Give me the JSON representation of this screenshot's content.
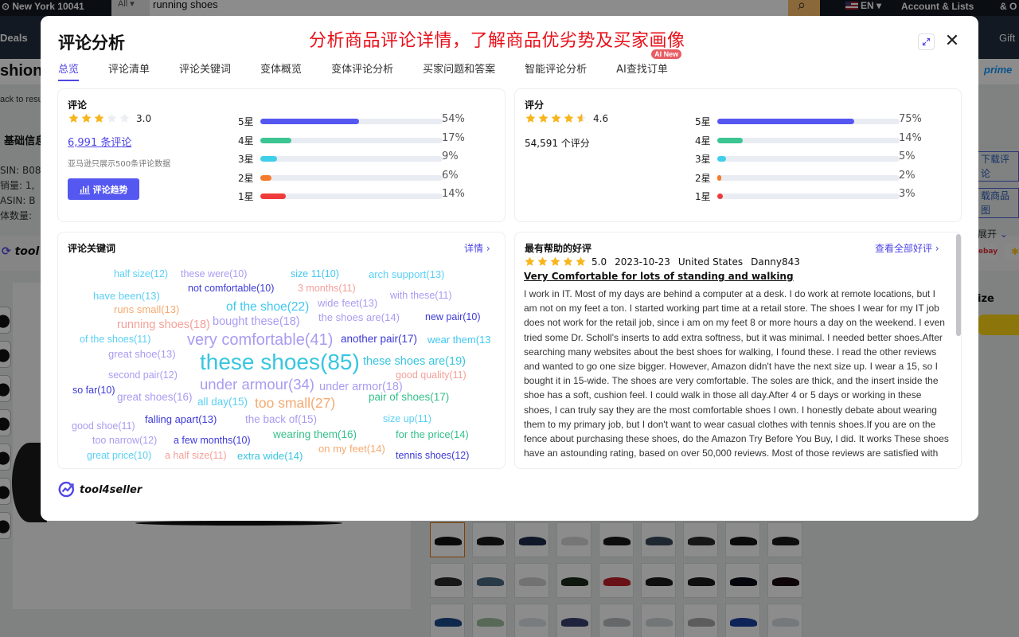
{
  "background": {
    "location": "New York 10041",
    "search_category": "All",
    "search_query": "running shoes",
    "language": "EN",
    "account": "Account & Lists",
    "orders": "& O",
    "nav_deals": "Deals",
    "nav_gift": "Gift",
    "page_heading": "shion",
    "prime": "prime",
    "back_link": "ack to resu",
    "basic_info": "基础信息",
    "info_rows": [
      "SIN:  B08",
      "销量:  1,",
      "ASIN:  B",
      "体数量:"
    ],
    "toolbar_brand": "tool",
    "right_links": [
      "下载评论",
      "载商品图"
    ],
    "expand_label": "展开",
    "size_label": "ize",
    "ebay": "ebay",
    "swatch_colors": [
      "#111",
      "#1a1a1a",
      "#1e2a4a",
      "#d8d8d8",
      "#181818",
      "#3a4a5a",
      "#2a2a2a",
      "#141414",
      "#1b1b1b",
      "#2b2b2b",
      "#4a6a80",
      "#d0d0d0",
      "#1b2b1b",
      "#c0202a",
      "#1a1a1a",
      "#1a1a1a",
      "#0a0a1a",
      "#1a0a10",
      "#1d4b8a",
      "#a0c0a0",
      "#dde2e8",
      "#3a4070",
      "#b8bcc0",
      "#cfd8d8",
      "#a8a8a8",
      "#1a40a0",
      "#d8dde2"
    ]
  },
  "modal": {
    "title": "评论分析",
    "banner": "分析商品评论详情，了解商品优劣势及买家画像",
    "tabs": [
      {
        "label": "总览",
        "active": true
      },
      {
        "label": "评论清单"
      },
      {
        "label": "评论关键词"
      },
      {
        "label": "变体概览"
      },
      {
        "label": "变体评论分析"
      },
      {
        "label": "买家问题和答案"
      },
      {
        "label": "智能评论分析"
      },
      {
        "label": "AI查找订单",
        "badge": "AI New"
      }
    ],
    "reviews": {
      "heading": "评论",
      "rating": 3.0,
      "rating_text": "3.0",
      "count_link": "6,991 条评论",
      "note": "亚马逊只展示500条评论数据",
      "trend_button": "评论趋势",
      "distribution": [
        {
          "label": "5星",
          "pct": 54,
          "pct_text": "54%",
          "color": "#5457f0"
        },
        {
          "label": "4星",
          "pct": 17,
          "pct_text": "17%",
          "color": "#3cc492"
        },
        {
          "label": "3星",
          "pct": 9,
          "pct_text": "9%",
          "color": "#40cfe8"
        },
        {
          "label": "2星",
          "pct": 6,
          "pct_text": "6%",
          "color": "#f57c2b"
        },
        {
          "label": "1星",
          "pct": 14,
          "pct_text": "14%",
          "color": "#ef3b3b"
        }
      ]
    },
    "ratings": {
      "heading": "评分",
      "rating": 4.6,
      "rating_text": "4.6",
      "count_text": "54,591 个评分",
      "distribution": [
        {
          "label": "5星",
          "pct": 75,
          "pct_text": "75%",
          "color": "#5457f0"
        },
        {
          "label": "4星",
          "pct": 14,
          "pct_text": "14%",
          "color": "#3cc492"
        },
        {
          "label": "3星",
          "pct": 5,
          "pct_text": "5%",
          "color": "#40cfe8"
        },
        {
          "label": "2星",
          "pct": 2,
          "pct_text": "2%",
          "color": "#f57c2b"
        },
        {
          "label": "1星",
          "pct": 3,
          "pct_text": "3%",
          "color": "#ef3b3b"
        }
      ]
    },
    "keywords": {
      "heading": "评论关键词",
      "detail_link": "详情 ›",
      "items": [
        {
          "text": "half size(12)",
          "count": 12,
          "color": "#5ad0f5"
        },
        {
          "text": "these were(10)",
          "count": 10,
          "color": "#a99cf2"
        },
        {
          "text": "size 11(10)",
          "count": 10,
          "color": "#40c8f0"
        },
        {
          "text": "arch support(13)",
          "count": 13,
          "color": "#5ad0f5"
        },
        {
          "text": "not comfortable(10)",
          "count": 10,
          "color": "#3d3ad6"
        },
        {
          "text": "3 months(11)",
          "count": 11,
          "color": "#f5a09a"
        },
        {
          "text": "have been(13)",
          "count": 13,
          "color": "#5ad0f5"
        },
        {
          "text": "with these(11)",
          "count": 11,
          "color": "#a99cf2"
        },
        {
          "text": "runs small(13)",
          "count": 13,
          "color": "#f5aa70"
        },
        {
          "text": "of the shoe(22)",
          "count": 22,
          "color": "#40c8f0"
        },
        {
          "text": "wide feet(13)",
          "count": 13,
          "color": "#a99cf2"
        },
        {
          "text": "running shoes(18)",
          "count": 18,
          "color": "#f5a09a"
        },
        {
          "text": "bought these(18)",
          "count": 18,
          "color": "#a99cf2"
        },
        {
          "text": "the shoes are(14)",
          "count": 14,
          "color": "#a99cf2"
        },
        {
          "text": "new pair(10)",
          "count": 10,
          "color": "#3d3ad6"
        },
        {
          "text": "of the shoes(11)",
          "count": 11,
          "color": "#5ad0f5"
        },
        {
          "text": "very comfortable(41)",
          "count": 41,
          "color": "#a99cf2"
        },
        {
          "text": "another pair(17)",
          "count": 17,
          "color": "#3d3ad6"
        },
        {
          "text": "wear them(13",
          "count": 13,
          "color": "#40c8f0"
        },
        {
          "text": "great shoe(13)",
          "count": 13,
          "color": "#a99cf2"
        },
        {
          "text": "these shoes(85)",
          "count": 85,
          "color": "#38c6e0"
        },
        {
          "text": "these shoes are(19)",
          "count": 19,
          "color": "#38c6e0"
        },
        {
          "text": "second pair(12)",
          "count": 12,
          "color": "#a99cf2"
        },
        {
          "text": "good quality(11)",
          "count": 11,
          "color": "#f5a09a"
        },
        {
          "text": "under armour(34)",
          "count": 34,
          "color": "#a99cf2"
        },
        {
          "text": "under armor(18)",
          "count": 18,
          "color": "#a99cf2"
        },
        {
          "text": "so far(10)",
          "count": 10,
          "color": "#3d3ad6"
        },
        {
          "text": "great shoes(16)",
          "count": 16,
          "color": "#a99cf2"
        },
        {
          "text": "all day(15)",
          "count": 15,
          "color": "#5ad0f5"
        },
        {
          "text": "too small(27)",
          "count": 27,
          "color": "#f5aa70"
        },
        {
          "text": "pair of shoes(17)",
          "count": 17,
          "color": "#36c08a"
        },
        {
          "text": "falling apart(13)",
          "count": 13,
          "color": "#3d3ad6"
        },
        {
          "text": "the back of(15)",
          "count": 15,
          "color": "#a99cf2"
        },
        {
          "text": "size up(11)",
          "count": 11,
          "color": "#5ad0f5"
        },
        {
          "text": "good shoe(11)",
          "count": 11,
          "color": "#a99cf2"
        },
        {
          "text": "wearing them(16)",
          "count": 16,
          "color": "#36c08a"
        },
        {
          "text": "for the price(14)",
          "count": 14,
          "color": "#36c08a"
        },
        {
          "text": "too narrow(12)",
          "count": 12,
          "color": "#a99cf2"
        },
        {
          "text": "a few months(10)",
          "count": 10,
          "color": "#3d3ad6"
        },
        {
          "text": "on my feet(14)",
          "count": 14,
          "color": "#f5aa70"
        },
        {
          "text": "great price(10)",
          "count": 10,
          "color": "#5ad0f5"
        },
        {
          "text": "a half size(11)",
          "count": 11,
          "color": "#f5a09a"
        },
        {
          "text": "extra wide(14)",
          "count": 14,
          "color": "#38c6e0"
        },
        {
          "text": "tennis shoes(12)",
          "count": 12,
          "color": "#3d3ad6"
        }
      ]
    },
    "best_review": {
      "heading": "最有帮助的好评",
      "view_all_link": "查看全部好评 ›",
      "rating": 5.0,
      "rating_text": "5.0",
      "date": "2023-10-23",
      "country": "United States",
      "author": "Danny843",
      "title": "Very Comfortable for lots of standing and walking",
      "body": "I work in IT. Most of my days are behind a computer at a desk. I do work at remote locations, but I am not on my feet a ton. I started working part time at a retail store. The shoes I wear for my IT job does not work for the retail job, since i am on my feet 8 or more hours a day on the weekend. I even tried some Dr. Scholl's inserts to add extra softness, but it was minimal. I needed better shoes.After searching many websites about the best shoes for walking, I found these. I read the other reviews and wanted to go one size bigger. However, Amazon didn't have the next size up. I wear a 15, so I bought it in 15-wide. The shoes are very comfortable. The soles are thick, and the insert inside the shoe has a soft, cushion feel. I could walk in those all day.After 4 or 5 days or working in these shoes, I can truly say they are the most comfortable shoes I own. I honestly debate about wearing them to my primary job, but I don't want to wear casual clothes with tennis shoes.If you are on the fence about purchasing these shoes, do the Amazon Try Before You Buy, I did. It works These shoes have an astounding rating, based on over 50,000 reviews. Most of those reviews are satisfied with"
    },
    "footer_brand": "tool4seller"
  }
}
